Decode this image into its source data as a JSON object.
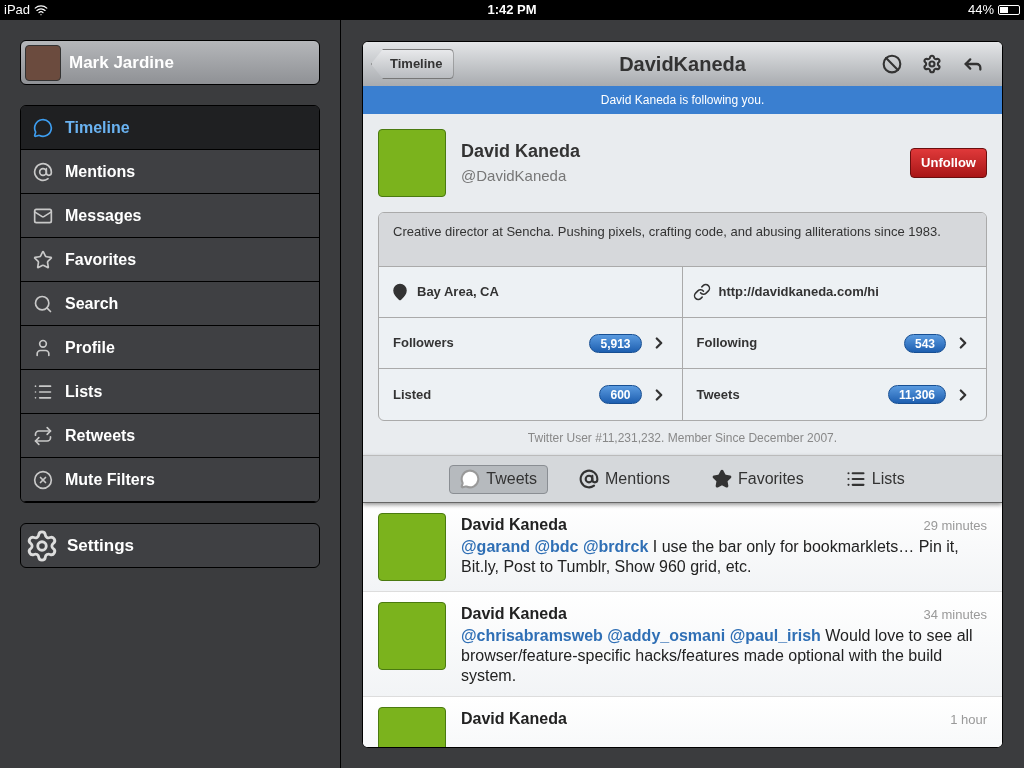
{
  "status_bar": {
    "device": "iPad",
    "time": "1:42 PM",
    "battery": "44%"
  },
  "sidebar": {
    "account": "Mark Jardine",
    "items": [
      {
        "label": "Timeline",
        "selected": true
      },
      {
        "label": "Mentions",
        "selected": false
      },
      {
        "label": "Messages",
        "selected": false
      },
      {
        "label": "Favorites",
        "selected": false
      },
      {
        "label": "Search",
        "selected": false
      },
      {
        "label": "Profile",
        "selected": false
      },
      {
        "label": "Lists",
        "selected": false
      },
      {
        "label": "Retweets",
        "selected": false
      },
      {
        "label": "Mute Filters",
        "selected": false
      }
    ],
    "settings": "Settings"
  },
  "nav": {
    "back": "Timeline",
    "title": "DavidKaneda"
  },
  "banner": "David Kaneda is following you.",
  "profile": {
    "name": "David Kaneda",
    "handle": "@DavidKaneda",
    "action": "Unfollow",
    "bio": "Creative director at Sencha. Pushing pixels, crafting code, and abusing alliterations since 1983.",
    "location": "Bay Area, CA",
    "url": "http://davidkaneda.com/hi",
    "stats": [
      {
        "label": "Followers",
        "count": "5,913"
      },
      {
        "label": "Following",
        "count": "543"
      },
      {
        "label": "Listed",
        "count": "600"
      },
      {
        "label": "Tweets",
        "count": "11,306"
      }
    ],
    "footer": "Twitter User #11,231,232. Member Since December 2007."
  },
  "tabs": [
    {
      "label": "Tweets",
      "selected": true
    },
    {
      "label": "Mentions",
      "selected": false
    },
    {
      "label": "Favorites",
      "selected": false
    },
    {
      "label": "Lists",
      "selected": false
    }
  ],
  "tweets": [
    {
      "author": "David Kaneda",
      "time": "29 minutes",
      "mentions": [
        "@garand",
        "@bdc",
        "@brdrck"
      ],
      "text": "I use the bar only for bookmarklets… Pin it, Bit.ly, Post to Tumblr, Show 960 grid, etc."
    },
    {
      "author": "David Kaneda",
      "time": "34 minutes",
      "mentions": [
        "@chrisabramsweb",
        "@addy_osmani",
        "@paul_irish"
      ],
      "text": "Would love to see all browser/feature-specific hacks/features made optional with the build system."
    },
    {
      "author": "David Kaneda",
      "time": "1 hour"
    }
  ]
}
